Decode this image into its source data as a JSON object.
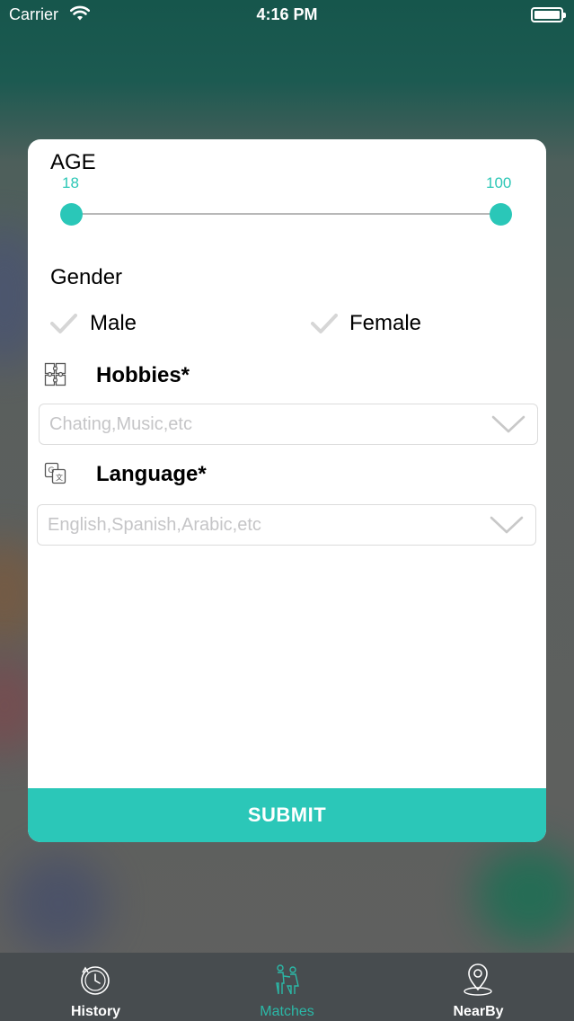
{
  "status_bar": {
    "carrier": "Carrier",
    "time": "4:16 PM"
  },
  "filter": {
    "age": {
      "title": "AGE",
      "min": "18",
      "max": "100"
    },
    "gender": {
      "title": "Gender",
      "options": [
        "Male",
        "Female"
      ]
    },
    "hobbies": {
      "title": "Hobbies*",
      "placeholder": "Chating,Music,etc"
    },
    "language": {
      "title": "Language*",
      "placeholder": "English,Spanish,Arabic,etc"
    },
    "submit_label": "SUBMIT"
  },
  "tabbar": {
    "items": [
      {
        "label": "History",
        "icon": "history-icon"
      },
      {
        "label": "Matches",
        "icon": "matches-icon",
        "active": true
      },
      {
        "label": "NearBy",
        "icon": "location-pin-icon"
      }
    ]
  },
  "colors": {
    "accent": "#2bc7b8",
    "tabbar": "#474c4f"
  }
}
